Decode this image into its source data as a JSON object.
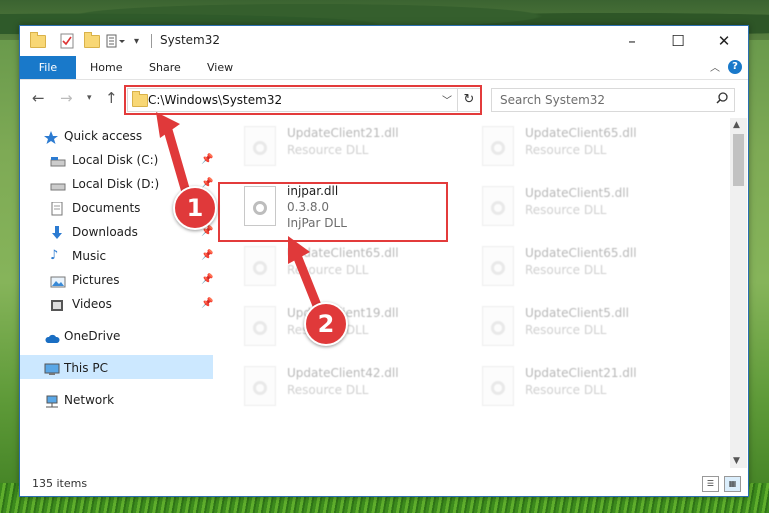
{
  "window": {
    "title": "System32"
  },
  "ribbon": {
    "file": "File",
    "tabs": [
      "Home",
      "Share",
      "View"
    ],
    "help": "?"
  },
  "address": {
    "path": "C:\\Windows\\System32"
  },
  "search": {
    "placeholder": "Search System32"
  },
  "nav": {
    "items": [
      {
        "label": "Quick access",
        "icon": "star-icon",
        "pinned": false
      },
      {
        "label": "Local Disk (C:)",
        "icon": "drive-icon",
        "pinned": true
      },
      {
        "label": "Local Disk (D:)",
        "icon": "drive-icon",
        "pinned": true
      },
      {
        "label": "Documents",
        "icon": "documents-icon",
        "pinned": true
      },
      {
        "label": "Downloads",
        "icon": "download-icon",
        "pinned": true
      },
      {
        "label": "Music",
        "icon": "music-icon",
        "pinned": true
      },
      {
        "label": "Pictures",
        "icon": "pictures-icon",
        "pinned": true
      },
      {
        "label": "Videos",
        "icon": "videos-icon",
        "pinned": true
      },
      {
        "label": "OneDrive",
        "icon": "cloud-icon",
        "pinned": false
      },
      {
        "label": "This PC",
        "icon": "computer-icon",
        "pinned": false,
        "selected": true
      },
      {
        "label": "Network",
        "icon": "network-icon",
        "pinned": false
      }
    ]
  },
  "files": {
    "left": [
      {
        "name": "UpdateClient21.dll",
        "desc": "Resource DLL"
      },
      {
        "name": "injpar.dll",
        "version": "0.3.8.0",
        "desc": "InjPar DLL"
      },
      {
        "name": "UpdateClient65.dll",
        "desc": "Resource DLL"
      },
      {
        "name": "UpdateClient19.dll",
        "desc": "Resource DLL"
      },
      {
        "name": "UpdateClient42.dll",
        "desc": "Resource DLL"
      }
    ],
    "right": [
      {
        "name": "UpdateClient65.dll",
        "desc": "Resource DLL"
      },
      {
        "name": "UpdateClient5.dll",
        "desc": "Resource DLL"
      },
      {
        "name": "UpdateClient65.dll",
        "desc": "Resource DLL"
      },
      {
        "name": "UpdateClient5.dll",
        "desc": "Resource DLL"
      },
      {
        "name": "UpdateClient21.dll",
        "desc": "Resource DLL"
      }
    ]
  },
  "status": {
    "count": "135 items"
  },
  "annotations": {
    "step1": "1",
    "step2": "2",
    "color": "#e0393a"
  }
}
